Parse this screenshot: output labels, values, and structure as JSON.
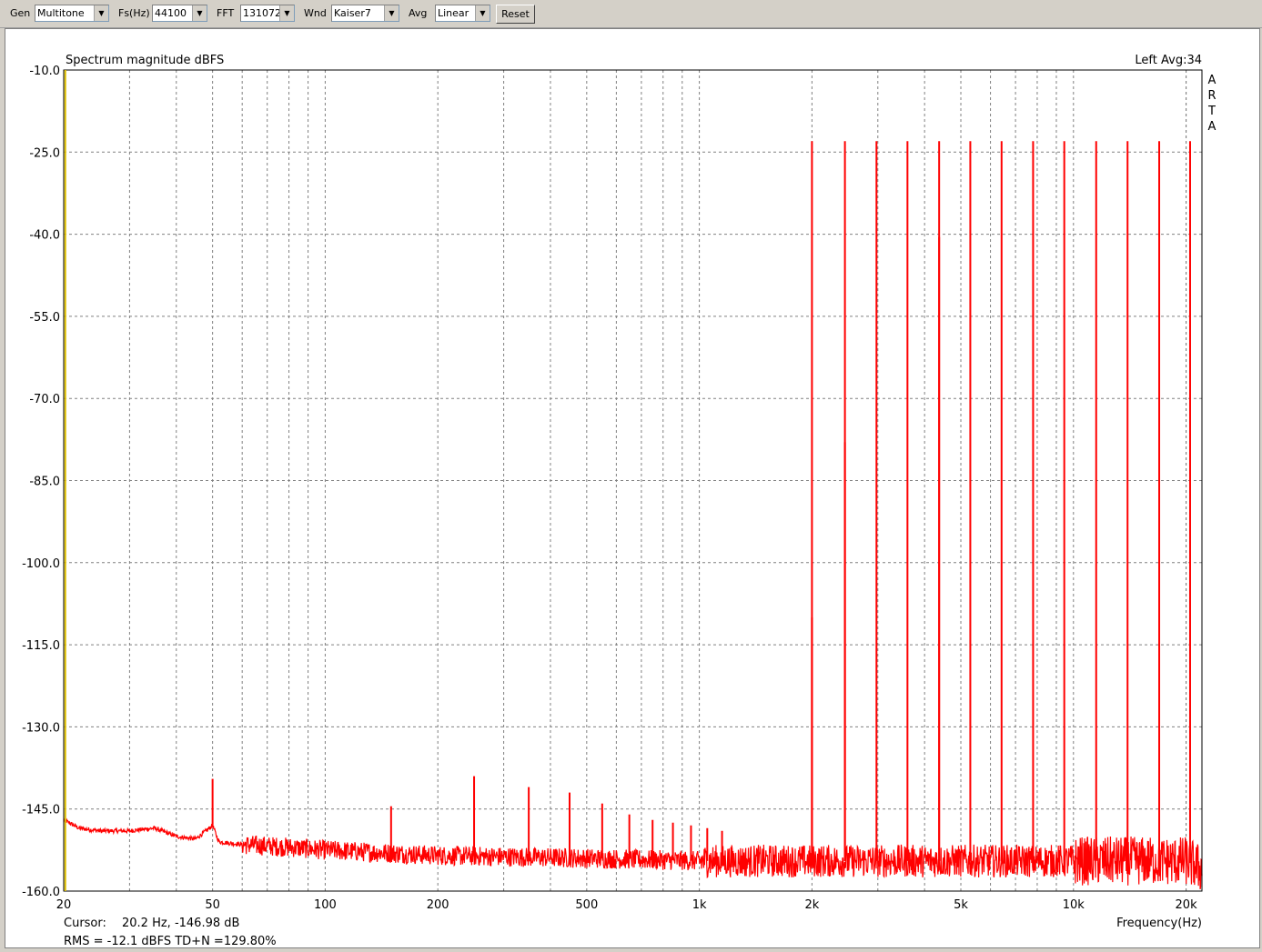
{
  "toolbar": {
    "gen_label": "Gen",
    "gen_value": "Multitone",
    "fs_label": "Fs(Hz)",
    "fs_value": "44100",
    "fft_label": "FFT",
    "fft_value": "131072",
    "wnd_label": "Wnd",
    "wnd_value": "Kaiser7",
    "avg_label": "Avg",
    "avg_value": "Linear",
    "reset_label": "Reset"
  },
  "plot": {
    "title": "Spectrum magnitude dBFS",
    "channel_info": "Left  Avg:34",
    "brand_letters": [
      "A",
      "R",
      "T",
      "A"
    ],
    "cursor_label": "Cursor:",
    "cursor_value": "20.2 Hz, -146.98 dB",
    "rms_text": "RMS =  -12.1 dBFS   TD+N =129.80%",
    "x_axis_label": "Frequency(Hz)"
  },
  "colors": {
    "trace": "#ff0000",
    "cursor_line": "#e0c000",
    "grid": "#808080",
    "rms_text": "#cc0000"
  },
  "chart_data": {
    "type": "line",
    "title": "Spectrum magnitude dBFS",
    "xlabel": "Frequency(Hz)",
    "ylabel": "",
    "x_scale": "log",
    "xlim": [
      20,
      22050
    ],
    "ylim": [
      -160,
      -10
    ],
    "grid": true,
    "y_ticks": [
      -10.0,
      -25.0,
      -40.0,
      -55.0,
      -70.0,
      -85.0,
      -100.0,
      -115.0,
      -130.0,
      -145.0,
      -160.0
    ],
    "y_tick_labels": [
      "-10.0",
      "-25.0",
      "-40.0",
      "-55.0",
      "-70.0",
      "-85.0",
      "-100.0",
      "-115.0",
      "-130.0",
      "-145.0",
      "-160.0"
    ],
    "x_ticks": [
      20,
      50,
      100,
      200,
      500,
      1000,
      2000,
      5000,
      10000,
      20000
    ],
    "x_tick_labels": [
      "20",
      "50",
      "100",
      "200",
      "500",
      "1k",
      "2k",
      "5k",
      "10k",
      "20k"
    ],
    "cursor_x": 20.2,
    "noise_floor_profile": {
      "x": [
        20,
        22,
        25,
        30,
        35,
        40,
        45,
        48,
        50,
        52,
        60,
        80,
        100,
        200,
        500,
        1000,
        2000,
        5000,
        10000,
        20000,
        22050
      ],
      "y": [
        -147,
        -148.5,
        -149,
        -149,
        -148.5,
        -150,
        -150.5,
        -149,
        -148,
        -151,
        -151.5,
        -152,
        -152.5,
        -153.5,
        -154,
        -154.5,
        -154.5,
        -154.5,
        -154.5,
        -154.5,
        -156
      ]
    },
    "series": [
      {
        "name": "",
        "tones": {
          "x": [
            2000,
            2450,
            2975,
            3600,
            4375,
            5300,
            6425,
            7800,
            9450,
            11500,
            13950,
            16950,
            20500
          ],
          "y": [
            -23,
            -23,
            -23,
            -23,
            -23,
            -23,
            -23,
            -23,
            -23,
            -23,
            -23,
            -23,
            -23
          ]
        },
        "spurs": {
          "x": [
            50,
            150,
            250,
            350,
            450,
            550,
            650,
            750,
            850,
            950,
            1050,
            1150,
            2000,
            2450,
            4375
          ],
          "y": [
            -139.5,
            -144.5,
            -139,
            -141,
            -142,
            -144,
            -146,
            -147,
            -147.5,
            -148,
            -148.5,
            -149,
            -110,
            -78,
            -40.5
          ]
        }
      }
    ]
  }
}
